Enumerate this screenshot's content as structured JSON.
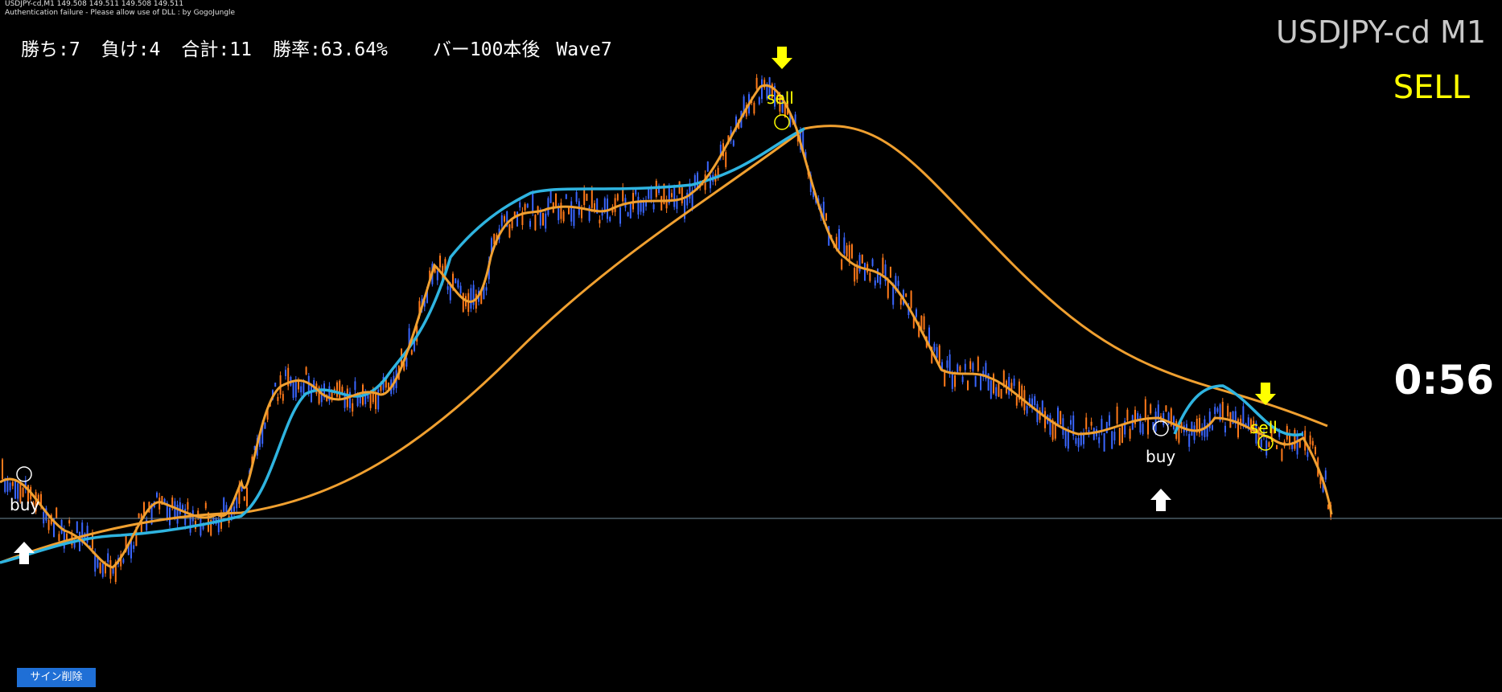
{
  "header": {
    "quote_line": "USDJPY-cd,M1  149.508 149.511 149.508 149.511",
    "auth_message": "Authentication failure - Please allow use of DLL : by GogoJungle"
  },
  "stats": {
    "wins": "勝ち:7",
    "losses": "負け:4",
    "total": "合計:11",
    "win_rate": "勝率:63.64%",
    "bars_after": "バー100本後",
    "wave": "Wave7"
  },
  "symbol_label": "USDJPY-cd M1",
  "signal_label": "SELL",
  "timer": "0:56",
  "button": {
    "clear_signs": "サイン削除"
  },
  "signals": [
    {
      "type": "buy",
      "label": "buy"
    },
    {
      "type": "sell",
      "label": "sell"
    },
    {
      "type": "buy",
      "label": "buy"
    },
    {
      "type": "sell",
      "label": "sell"
    }
  ],
  "colors": {
    "background": "#000000",
    "bull_candle": "#3a66ff",
    "bear_candle": "#ff7a1a",
    "fast_ma": "#f0a030",
    "slow_ma": "#2fb4e0",
    "sell_arrow": "#ffff00",
    "buy_arrow": "#ffffff",
    "price_line": "#708a9a",
    "button": "#1f6fd6"
  }
}
